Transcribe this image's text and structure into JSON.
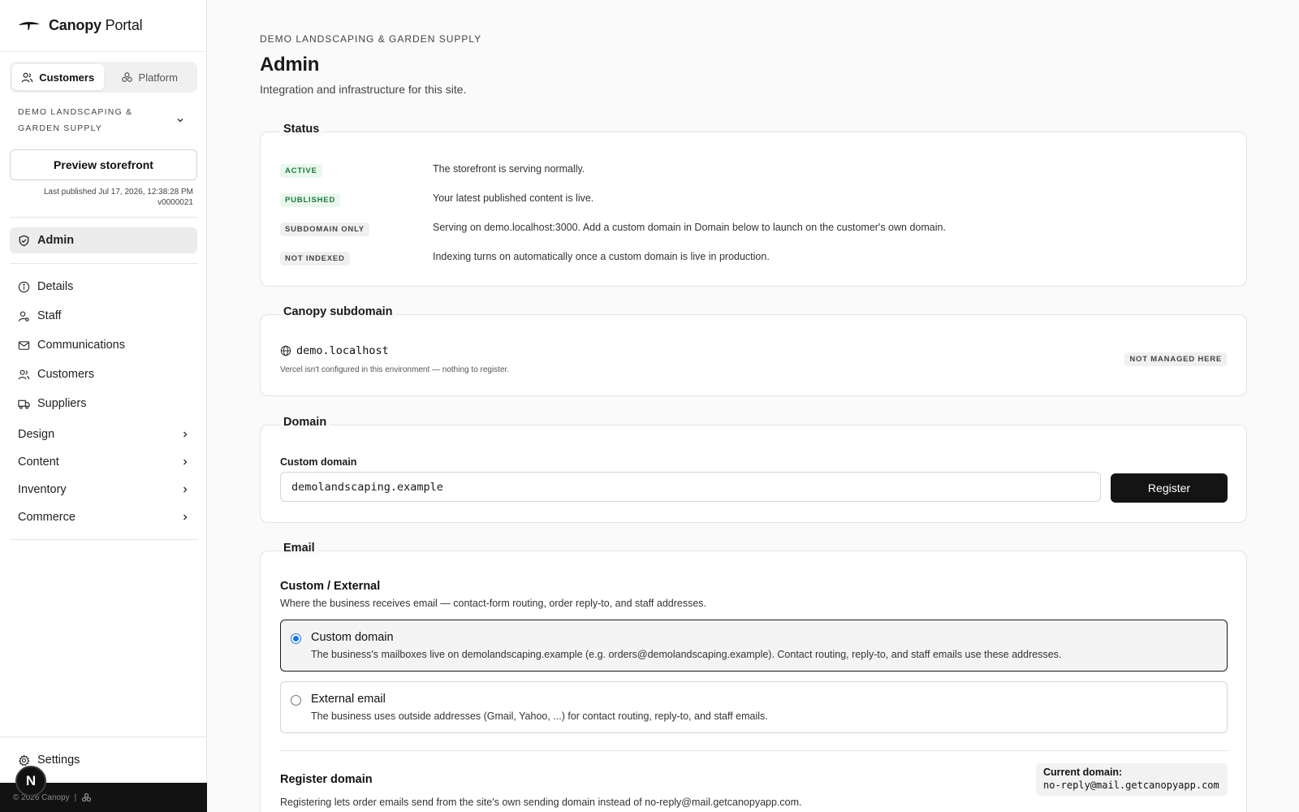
{
  "sidebar": {
    "brand": {
      "name": "Canopy",
      "suffix": "Portal"
    },
    "segments": [
      {
        "label": "Customers",
        "icon": "users-icon",
        "active": true
      },
      {
        "label": "Platform",
        "icon": "platform-icon",
        "active": false
      }
    ],
    "site_name": "Demo Landscaping & Garden Supply",
    "preview_label": "Preview storefront",
    "published_line": "Last published Jul 17, 2026, 12:38:28 PM",
    "version": "v0000021",
    "admin_label": "Admin",
    "items": [
      {
        "label": "Details",
        "icon": "info-icon"
      },
      {
        "label": "Staff",
        "icon": "staff-icon"
      },
      {
        "label": "Communications",
        "icon": "mail-icon"
      },
      {
        "label": "Customers",
        "icon": "users-icon"
      },
      {
        "label": "Suppliers",
        "icon": "truck-icon"
      }
    ],
    "groups": [
      {
        "label": "Design"
      },
      {
        "label": "Content"
      },
      {
        "label": "Inventory"
      },
      {
        "label": "Commerce"
      }
    ],
    "settings_label": "Settings",
    "footer_copyright": "© 2026 Canopy",
    "footer_sep": "|",
    "badge_letter": "N"
  },
  "main": {
    "eyebrow": "Demo Landscaping & Garden Supply",
    "title": "Admin",
    "subtitle": "Integration and infrastructure for this site.",
    "status": {
      "legend": "Status",
      "rows": [
        {
          "badge": "ACTIVE",
          "tone": "green",
          "text": "The storefront is serving normally."
        },
        {
          "badge": "PUBLISHED",
          "tone": "green",
          "text": "Your latest published content is live."
        },
        {
          "badge": "SUBDOMAIN ONLY",
          "tone": "gray",
          "text": "Serving on demo.localhost:3000. Add a custom domain in Domain below to launch on the customer's own domain."
        },
        {
          "badge": "NOT INDEXED",
          "tone": "gray",
          "text": "Indexing turns on automatically once a custom domain is live in production."
        }
      ]
    },
    "subdomain": {
      "legend": "Canopy subdomain",
      "host": "demo.localhost",
      "note": "Vercel isn't configured in this environment — nothing to register.",
      "badge": "NOT MANAGED HERE"
    },
    "domain": {
      "legend": "Domain",
      "field_label": "Custom domain",
      "value": "demolandscaping.example",
      "button": "Register"
    },
    "email": {
      "legend": "Email",
      "heading": "Custom / External",
      "description": "Where the business receives email — contact-form routing, order reply-to, and staff addresses.",
      "options": [
        {
          "title": "Custom domain",
          "desc": "The business's mailboxes live on demolandscaping.example (e.g. orders@demolandscaping.example). Contact routing, reply-to, and staff emails use these addresses.",
          "selected": true
        },
        {
          "title": "External email",
          "desc": "The business uses outside addresses (Gmail, Yahoo, ...) for contact routing, reply-to, and staff emails.",
          "selected": false
        }
      ],
      "register_heading": "Register domain",
      "register_desc": "Registering lets order emails send from the site's own sending domain instead of no-reply@mail.getcanopyapp.com.",
      "current_label": "Current domain:",
      "current_value": "no-reply@mail.getcanopyapp.com"
    }
  },
  "colors": {
    "accent_dark": "#141414",
    "status_green_bg": "#eaf7ee",
    "status_green_text": "#1b7a3d",
    "radio_blue": "#1a73e8"
  }
}
